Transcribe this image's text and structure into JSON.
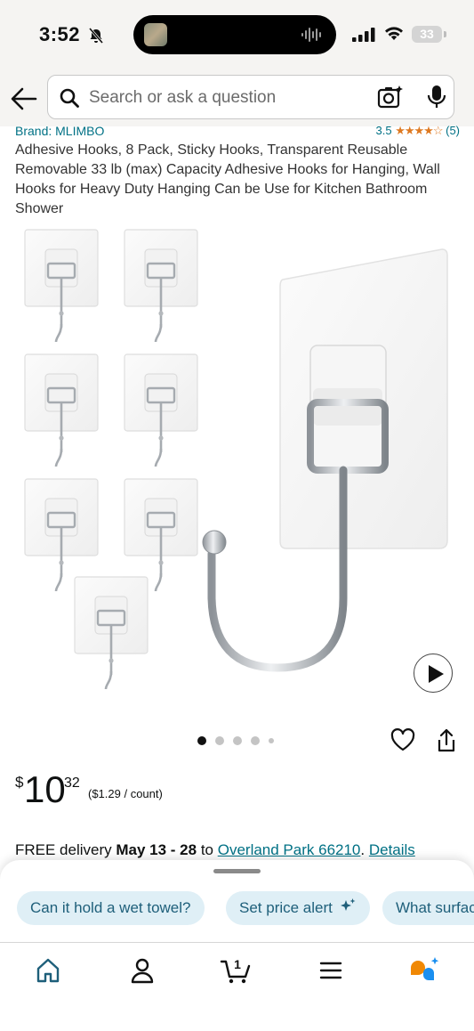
{
  "status_bar": {
    "time": "3:52",
    "battery": "33"
  },
  "search": {
    "placeholder": "Search or ask a question"
  },
  "product": {
    "brand": "Brand: MLIMBO",
    "rating": {
      "score": "3.5",
      "stars": "★★★★☆",
      "count": "(5)"
    },
    "title": "Adhesive Hooks, 8 Pack, Sticky Hooks, Transparent Reusable Removable 33 lb (max) Capacity Adhesive Hooks for Hanging, Wall Hooks for Heavy Duty Hanging Can be Use for Kitchen Bathroom Shower",
    "image_index": 1,
    "image_count": 5
  },
  "price": {
    "currency": "$",
    "whole": "10",
    "fraction": "32",
    "unit_price": "($1.29 / count)"
  },
  "delivery": {
    "prefix": "FREE delivery ",
    "dates": "May 13 - 28",
    "to": " to ",
    "location": "Overland Park 66210",
    "sep": ". ",
    "details": "Details"
  },
  "suggestions": [
    "Can it hold a wet towel?",
    "Set price alert",
    "What surfaces does it stick to?"
  ],
  "bottom_nav": {
    "cart_count": "1",
    "items": [
      "home-icon",
      "account-icon",
      "cart-icon",
      "menu-icon",
      "rufus-icon"
    ]
  },
  "colors": {
    "link": "#007185",
    "star": "#de7921",
    "chip_bg": "#dfeff6",
    "nav_active": "#1e5f7a"
  }
}
